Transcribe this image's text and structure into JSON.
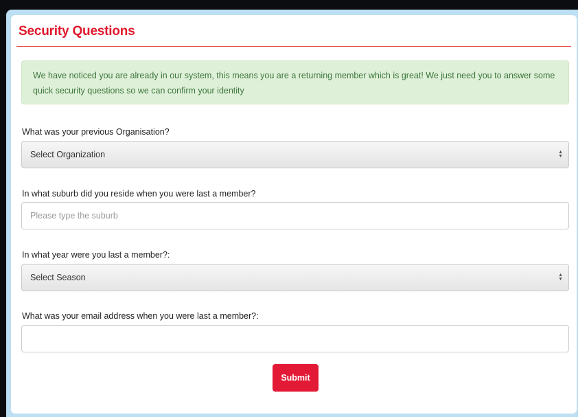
{
  "page": {
    "title": "Security Questions",
    "accent_color": "#e0182c",
    "notice_bg": "#dff0d8",
    "notice_text_color": "#3c763d"
  },
  "notice": {
    "text": "We have noticed you are already in our system, this means you are a returning member which is great! We just need you to answer some quick security questions so we can confirm your identity"
  },
  "questions": {
    "organisation": {
      "label": "What was your previous Organisation?",
      "selected": "Select Organization"
    },
    "suburb": {
      "label": "In what suburb did you reside when you were last a member?",
      "placeholder": "Please type the suburb",
      "value": ""
    },
    "year": {
      "label": "In what year were you last a member?:",
      "selected": "Select Season"
    },
    "email": {
      "label": "What was your email address when you were last a member?:",
      "placeholder": "",
      "value": ""
    }
  },
  "actions": {
    "submit_label": "Submit"
  },
  "icons": {
    "select_arrows": "up-down-chevron-icon"
  }
}
